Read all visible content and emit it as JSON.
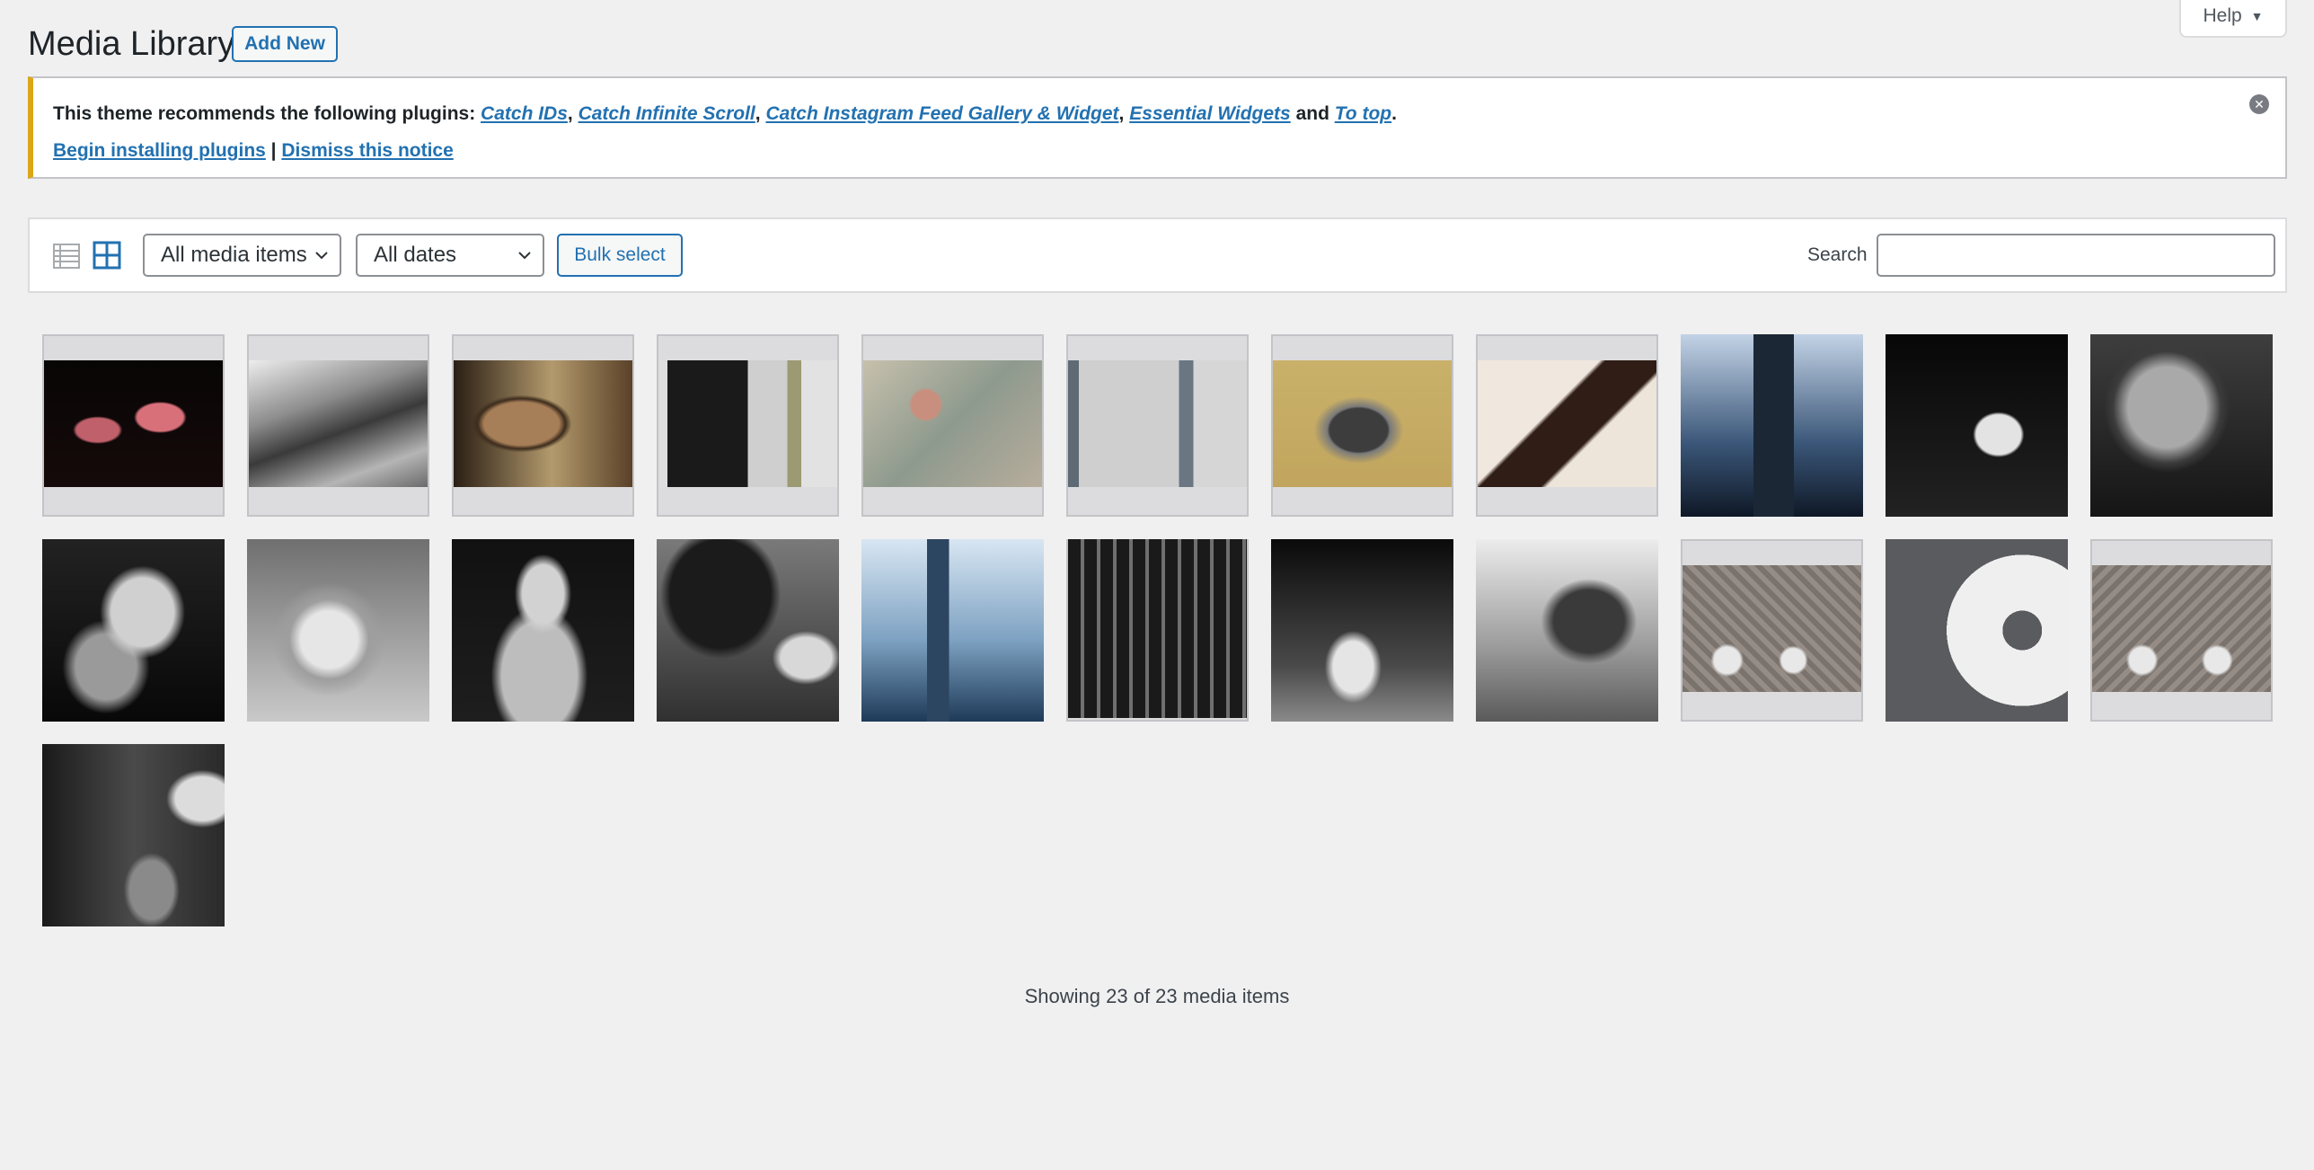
{
  "header": {
    "title": "Media Library",
    "add_new": "Add New",
    "help": "Help"
  },
  "notice": {
    "lead": "This theme recommends the following plugins: ",
    "plugins": [
      "Catch IDs",
      "Catch Infinite Scroll",
      "Catch Instagram Feed Gallery & Widget",
      "Essential Widgets",
      "To top"
    ],
    "sep": ", ",
    "and": " and ",
    "end": ".",
    "begin_link": "Begin installing plugins",
    "pipe": " | ",
    "dismiss_link": "Dismiss this notice"
  },
  "toolbar": {
    "media_type": "All media items",
    "date": "All dates",
    "bulk_select": "Bulk select",
    "search_label": "Search",
    "search_value": ""
  },
  "footer": {
    "count_text": "Showing 23 of 23 media items"
  },
  "colors": {
    "accent": "#2271b1",
    "notice_border": "#dba617",
    "background": "#f0f0f1"
  }
}
